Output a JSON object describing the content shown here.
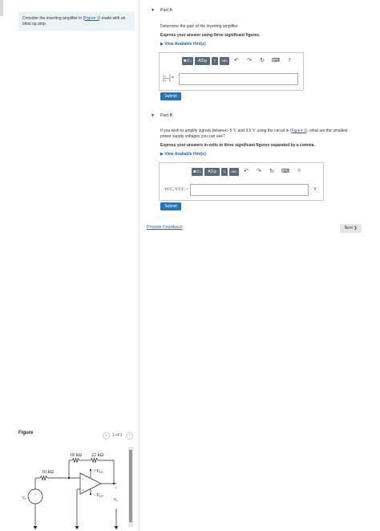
{
  "problem": {
    "text_prefix": "Consider the inverting amplifier in (",
    "figure_link": "Figure 1",
    "text_suffix": ") made with an ideal op amp."
  },
  "partA": {
    "title": "Part A",
    "question": "Determine the gain of the inverting amplifier.",
    "instruction": "Express your answer using three significant figures.",
    "hint": "View Available Hint(s)",
    "answer_label": "=",
    "submit": "Submit"
  },
  "partB": {
    "title": "Part B",
    "question_line1_a": "If you wish to amplify signals between -5 ",
    "question_v1": "V",
    "question_line1_b": " and 3.5 ",
    "question_v2": "V",
    "question_line1_c": " using the circuit in (",
    "figure_link": "Figure 1",
    "question_line1_d": "), what are the smallest",
    "question_line2": "power supply voltages you can use?",
    "instruction": "Express your answers in volts to three significant figures separated by a comma.",
    "hint": "View Available Hint(s)",
    "answer_label": "VCC, V′CC =",
    "unit": "V",
    "submit": "Submit"
  },
  "toolbar": {
    "templates": "■√□",
    "greek": "AΣφ",
    "arrows": "↕",
    "vec": "vec",
    "undo": "↶",
    "redo": "↷",
    "reset": "↻",
    "keyboard": "⌨",
    "help": "?"
  },
  "feedback_link": "Provide Feedback",
  "next_button": "Next ❯",
  "figure": {
    "label": "Figure",
    "pager": "1 of 1",
    "prev": "‹",
    "next": "›",
    "r1": "10 kΩ",
    "rf1": "18 kΩ",
    "rf2": "22 kΩ",
    "vcc_pos": "+V",
    "vcc_neg": "−V",
    "vcc_sub": "CC",
    "vs": "v",
    "vs_sub": "s",
    "vo": "v",
    "vo_sub": "o",
    "plus": "+",
    "minus": "−"
  }
}
